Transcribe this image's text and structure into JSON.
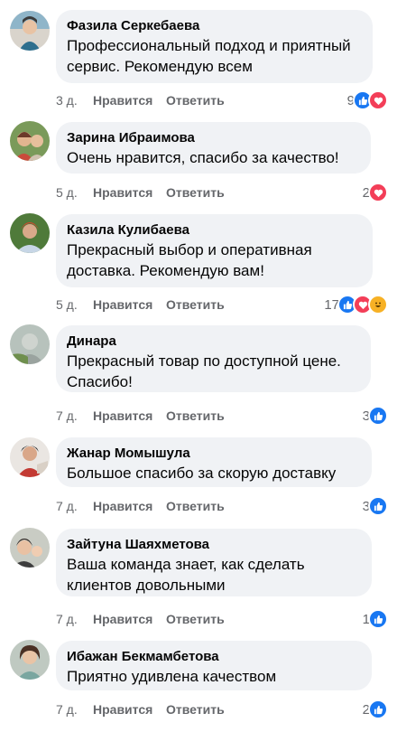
{
  "actions": {
    "like_label": "Нравится",
    "reply_label": "Ответить"
  },
  "colors": {
    "like": "#1877f2",
    "love": "#f33e58",
    "haha": "#f7b125",
    "bubble": "#f0f2f5",
    "meta": "#65676b"
  },
  "comments": [
    {
      "author": "Фазила Серкебаева",
      "text": "Профессиональный подход и приятный сервис. Рекомендую всем",
      "time": "3 д.",
      "reaction_count": "9",
      "reactions": [
        "like-icon",
        "love-icon"
      ]
    },
    {
      "author": "Зарина Ибраимова",
      "text": "Очень нравится, спасибо за качество!",
      "time": "5 д.",
      "reaction_count": "2",
      "reactions": [
        "love-icon"
      ]
    },
    {
      "author": "Казила Кулибаева",
      "text": "Прекрасный выбор и оперативная доставка. Рекомендую вам!",
      "time": "5 д.",
      "reaction_count": "17",
      "reactions": [
        "like-icon",
        "love-icon",
        "haha-icon"
      ]
    },
    {
      "author": "Динара",
      "text": "Прекрасный товар по доступной цене. Спасибо!",
      "time": "7 д.",
      "reaction_count": "3",
      "reactions": [
        "like-icon"
      ]
    },
    {
      "author": "Жанар Момышула",
      "text": "Большое спасибо за скорую доставку",
      "time": "7 д.",
      "reaction_count": "3",
      "reactions": [
        "like-icon"
      ]
    },
    {
      "author": "Зайтуна Шаяхметова",
      "text": "Ваша команда знает, как сделать клиентов довольными",
      "time": "7 д.",
      "reaction_count": "1",
      "reactions": [
        "like-icon"
      ]
    },
    {
      "author": "Ибажан Бекмамбетова",
      "text": "Приятно удивлена качеством",
      "time": "7 д.",
      "reaction_count": "2",
      "reactions": [
        "like-icon"
      ]
    }
  ]
}
